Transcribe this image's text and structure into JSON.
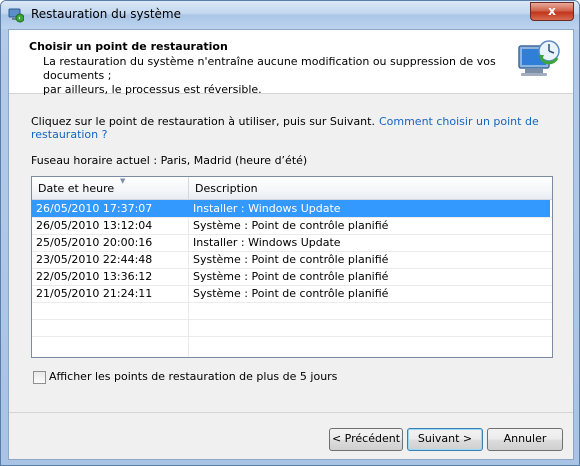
{
  "window": {
    "title": "Restauration du système",
    "close_label": "x"
  },
  "header": {
    "title": "Choisir un point de restauration",
    "subtitle_line1": "La restauration du système n'entraîne aucune modification ou suppression de vos documents ;",
    "subtitle_line2": "par ailleurs, le processus est réversible."
  },
  "instructions": {
    "text": "Cliquez sur le point de restauration à utiliser, puis sur Suivant.",
    "link": "Comment choisir un point de restauration ?"
  },
  "timezone": "Fuseau horaire actuel : Paris, Madrid (heure d’été)",
  "list": {
    "columns": [
      "Date et heure",
      "Description"
    ],
    "rows": [
      {
        "date": "26/05/2010 17:37:07",
        "description": "Installer : Windows Update",
        "selected": true
      },
      {
        "date": "26/05/2010 13:12:04",
        "description": "Système : Point de contrôle planifié"
      },
      {
        "date": "25/05/2010 20:00:16",
        "description": "Installer : Windows Update"
      },
      {
        "date": "23/05/2010 22:44:48",
        "description": "Système : Point de contrôle planifié"
      },
      {
        "date": "22/05/2010 13:36:12",
        "description": "Système : Point de contrôle planifié"
      },
      {
        "date": "21/05/2010 21:24:11",
        "description": "Système : Point de contrôle planifié"
      }
    ]
  },
  "checkbox": {
    "label": "Afficher les points de restauration de plus de 5 jours",
    "checked": false
  },
  "buttons": {
    "prev": "< Précédent",
    "next": "Suivant >",
    "cancel": "Annuler"
  },
  "colors": {
    "selection": "#3399ff",
    "link": "#1565c0",
    "title_bar": "#aac5e6"
  }
}
